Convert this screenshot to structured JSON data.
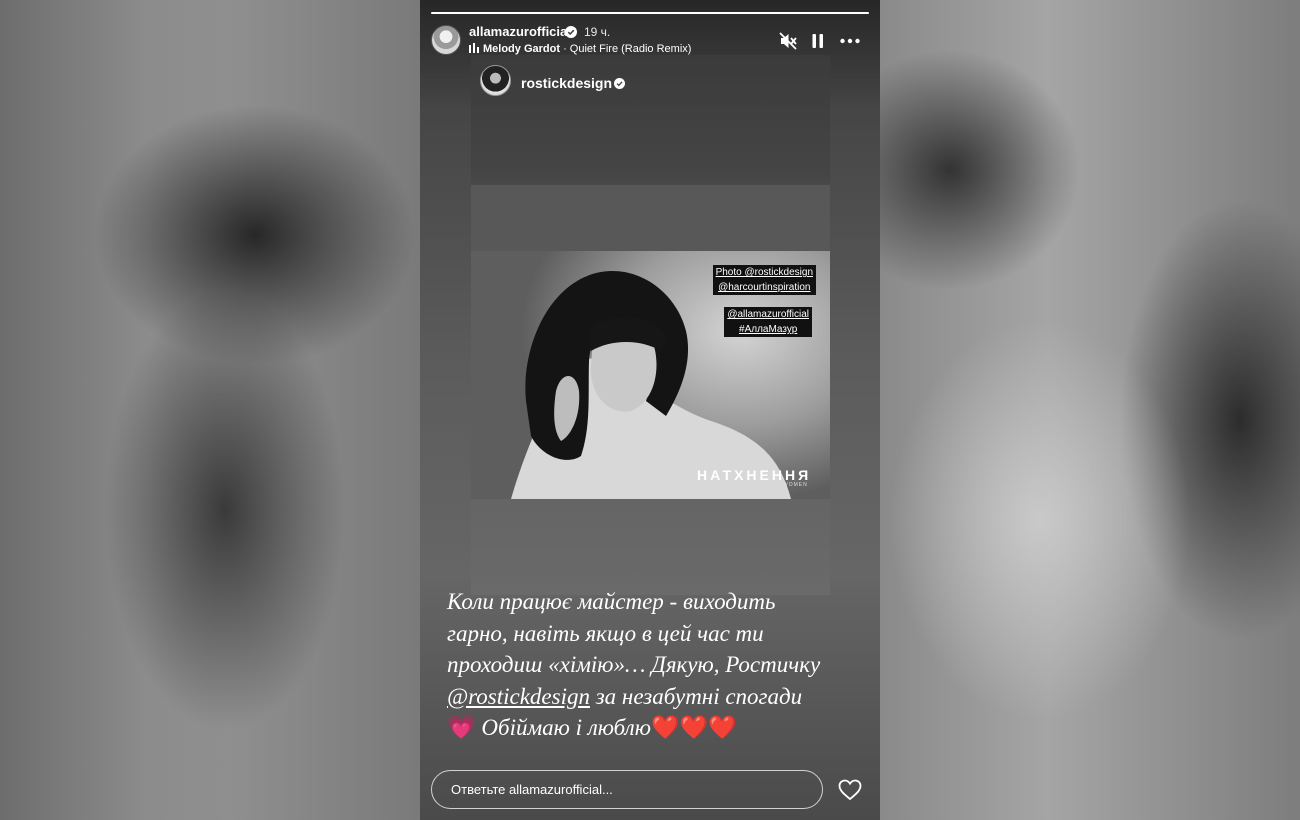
{
  "story": {
    "progress": 1.0,
    "username": "allamazurofficial",
    "time": "19 ч.",
    "music_artist": "Melody Gardot",
    "music_separator": " · ",
    "music_track": "Quiet Fire (Radio Remix)",
    "controls": {
      "mute_icon": "speaker-muted-icon",
      "pause_icon": "pause-icon",
      "more_icon": "more-horizontal-icon"
    }
  },
  "shared_post": {
    "username": "rostickdesign",
    "photo_tags": [
      [
        "Photo @rostickdesign",
        "@harcourtinspiration"
      ],
      [
        "@allamazurofficial",
        "#АллаМазур"
      ]
    ],
    "watermark": "НАТХНЕННЯ",
    "watermark_sub": "WOMEN"
  },
  "caption": {
    "line1": "Коли працює майстер - виходить",
    "line2": "гарно, навіть якщо в цей час ти",
    "line3": "проходиш «хімію»… Дякую, Ростичку",
    "mention": "@rostickdesign",
    "line4_rest": " за незабутні спогади",
    "emoji_pink": "💗",
    "line5": " Обіймаю і люблю",
    "hearts": "❤️❤️❤️"
  },
  "reply": {
    "placeholder": "Ответьте allamazurofficial..."
  },
  "colors": {
    "accent_heart": "#ff2d55",
    "text": "#ffffff"
  }
}
